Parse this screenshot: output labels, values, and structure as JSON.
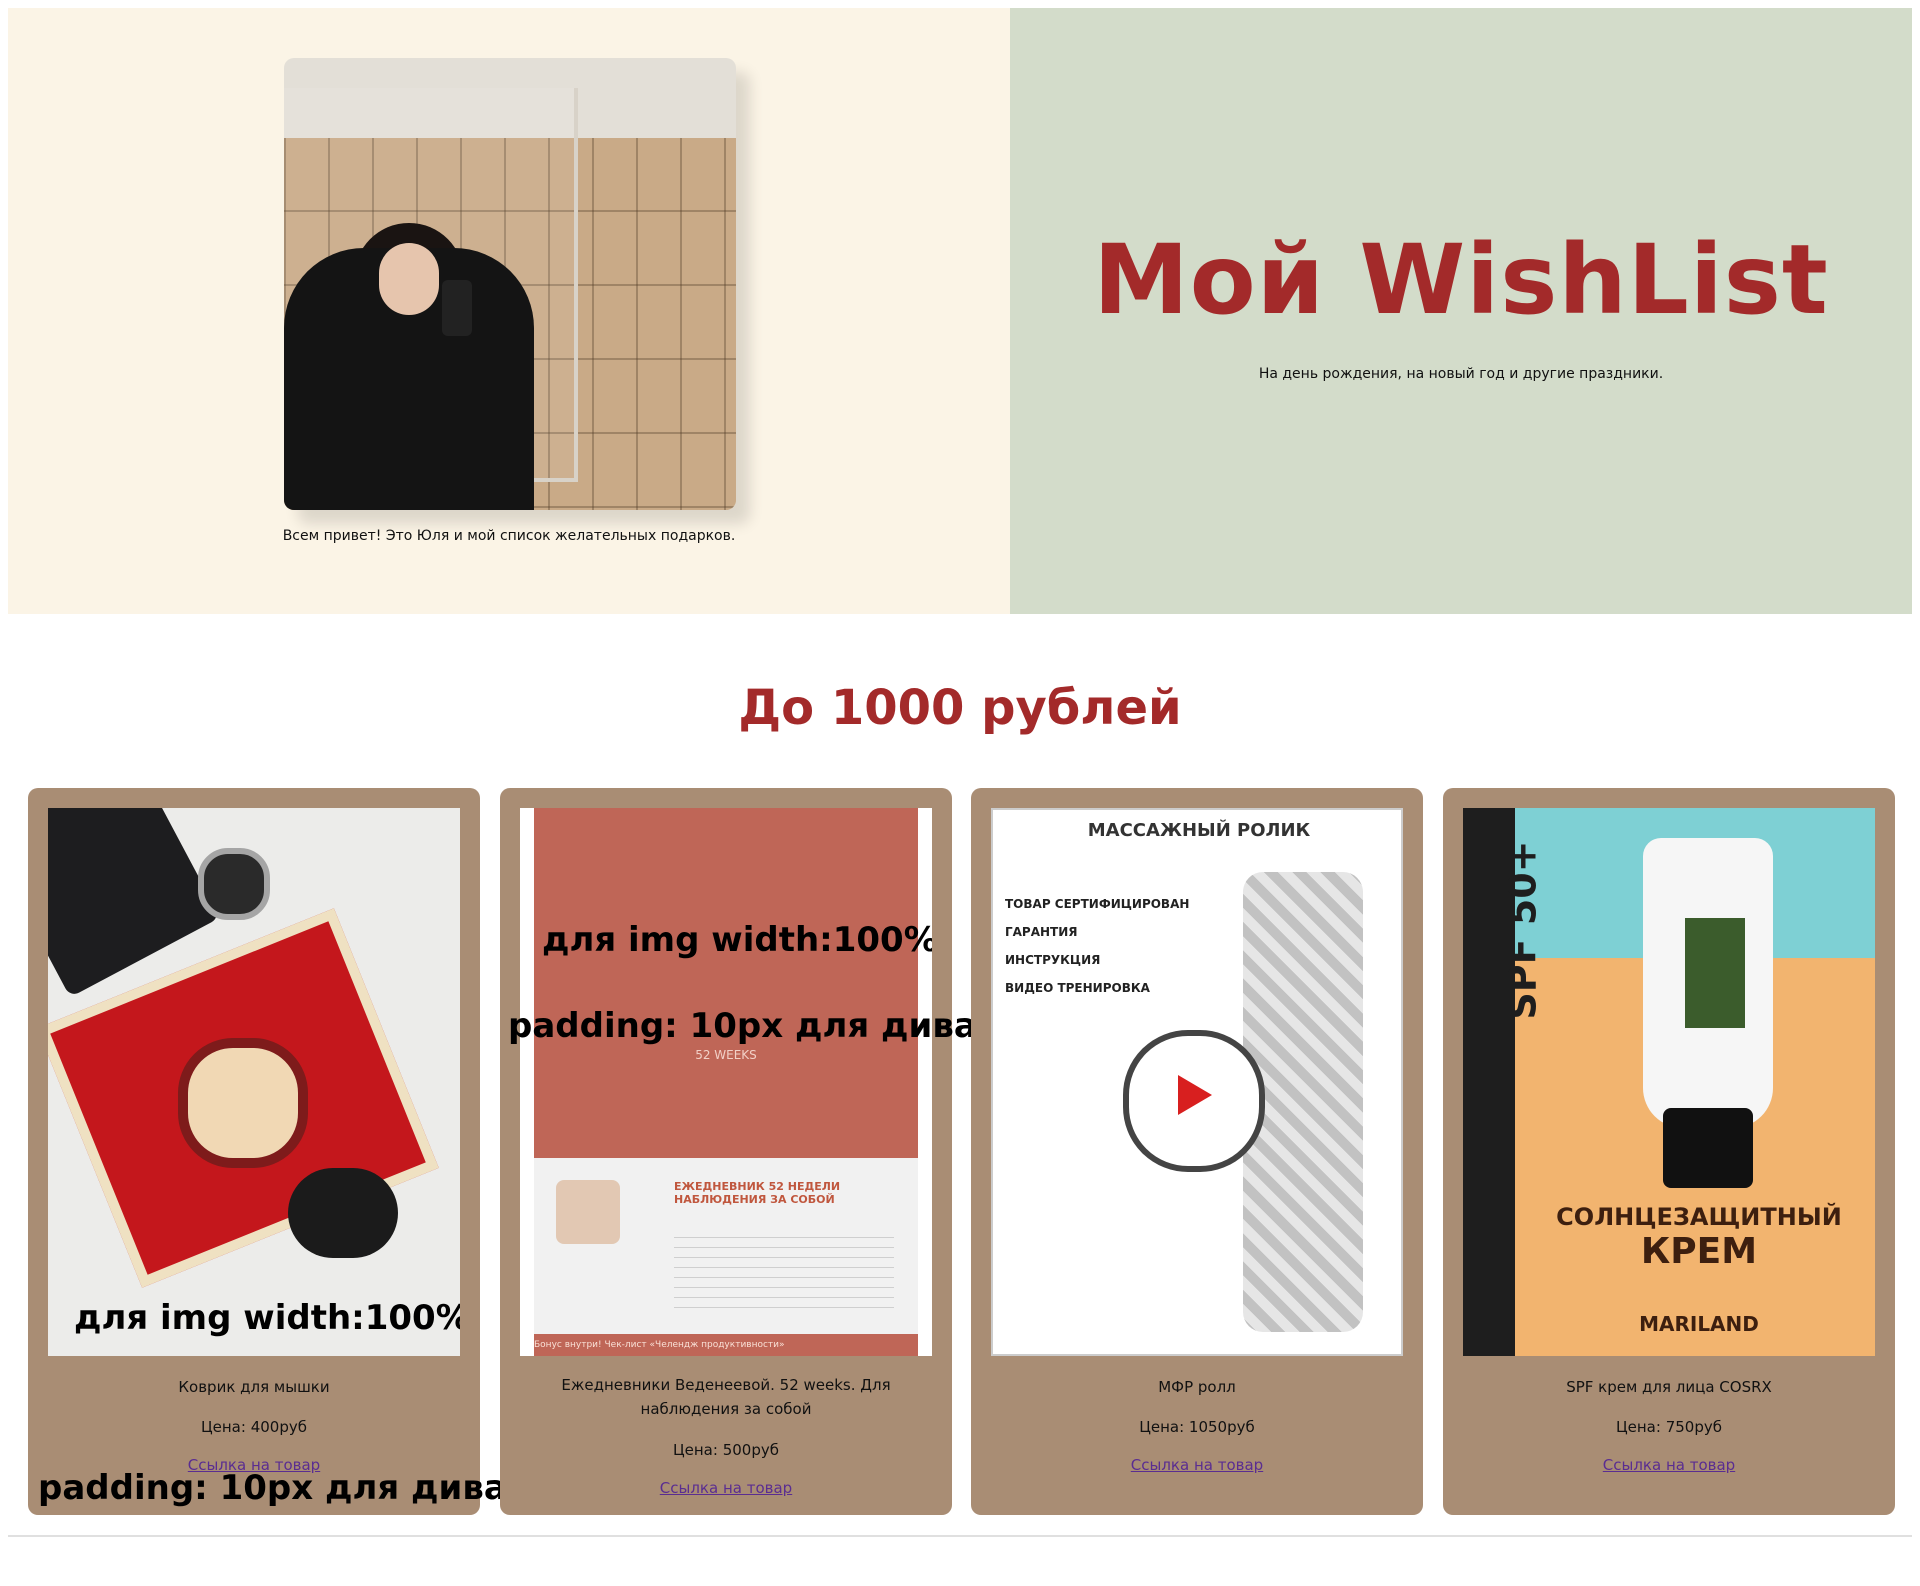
{
  "hero": {
    "greeting": "Всем привет! Это Юля и мой список желательных подарков.",
    "title": "Мой WishList",
    "subtitle": "На день рождения, на новый год и другие праздники."
  },
  "section": {
    "title": "До 1000 рублей"
  },
  "cards": [
    {
      "name": "Коврик для мышки",
      "price": "Цена: 400руб",
      "link": "Ссылка на товар",
      "overlay_img": "для img width:100%",
      "overlay_div": "padding: 10px для дива"
    },
    {
      "name": "Ежедневники Веденеевой. 52 weeks. Для наблюдения за собой",
      "price": "Цена: 500руб",
      "link": "Ссылка на товар",
      "overlay_img": "для img width:100%",
      "overlay_div": "padding: 10px для дива",
      "image_text": {
        "subhead": "52 WEEKS",
        "heading": "ЕЖЕДНЕВНИК 52 НЕДЕЛИ НАБЛЮДЕНИЯ ЗА СОБОЙ",
        "footer": "Бонус внутри! Чек-лист «Челендж продуктивности»"
      }
    },
    {
      "name": "МФР ролл",
      "price": "Цена: 1050руб",
      "link": "Ссылка на товар",
      "image_text": {
        "header": "МАССАЖНЫЙ РОЛИК",
        "features": [
          "ТОВАР СЕРТИФИЦИРОВАН",
          "ГАРАНТИЯ",
          "ИНСТРУКЦИЯ",
          "ВИДЕО ТРЕНИРОВКА"
        ]
      }
    },
    {
      "name": "SPF крем для лица COSRX",
      "price": "Цена: 750руб",
      "link": "Ссылка на товар",
      "image_text": {
        "spf": "SPF 50+",
        "product_line1": "СОЛНЦЕЗАЩИТНЫЙ",
        "product_line2": "КРЕМ",
        "brand": "MARILAND"
      }
    }
  ],
  "colors": {
    "accent": "#a32a2a",
    "card_bg": "#a98d74",
    "hero_left": "#fbf4e6",
    "hero_right": "#d3dcca"
  }
}
